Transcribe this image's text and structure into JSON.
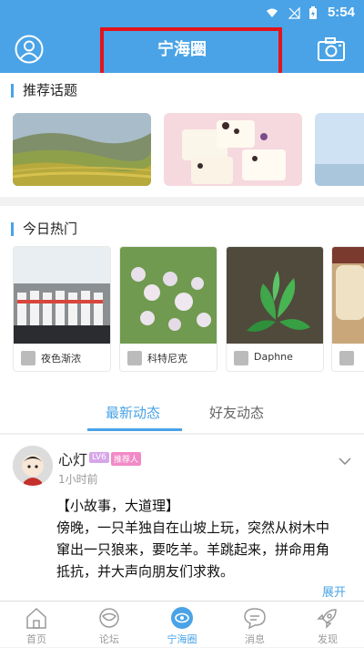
{
  "status_bar": {
    "time": "5:54"
  },
  "header": {
    "title": "宁海圈"
  },
  "topics": {
    "title": "推荐话题"
  },
  "hot_today": {
    "title": "今日热门",
    "items": [
      {
        "user": "夜色渐浓"
      },
      {
        "user": "科特尼克"
      },
      {
        "user": "Daphne"
      },
      {
        "user": ""
      }
    ]
  },
  "tabs": [
    {
      "label": "最新动态",
      "active": true
    },
    {
      "label": "好友动态",
      "active": false
    }
  ],
  "post": {
    "author": "心灯",
    "badges": [
      {
        "text": "LV6",
        "color": "#d6a6e8"
      },
      {
        "text": "推荐人",
        "color": "#f28ac7"
      }
    ],
    "time": "1小时前",
    "lines": [
      "【小故事，大道理】",
      "傍晚，一只羊独自在山坡上玩，突然从树木中",
      "窜出一只狼来，要吃羊。羊跳起来，拼命用角",
      "抵抗，并大声向朋友们求救。"
    ],
    "expand_label": "展开"
  },
  "bottom_nav": [
    {
      "label": "首页",
      "icon": "home-icon",
      "active": false
    },
    {
      "label": "论坛",
      "icon": "forum-icon",
      "active": false
    },
    {
      "label": "宁海圈",
      "icon": "circle-eye-icon",
      "active": true
    },
    {
      "label": "消息",
      "icon": "message-icon",
      "active": false
    },
    {
      "label": "发现",
      "icon": "rocket-icon",
      "active": false
    }
  ],
  "colors": {
    "accent": "#4aa3e6",
    "highlight_box": "#e3141b"
  }
}
